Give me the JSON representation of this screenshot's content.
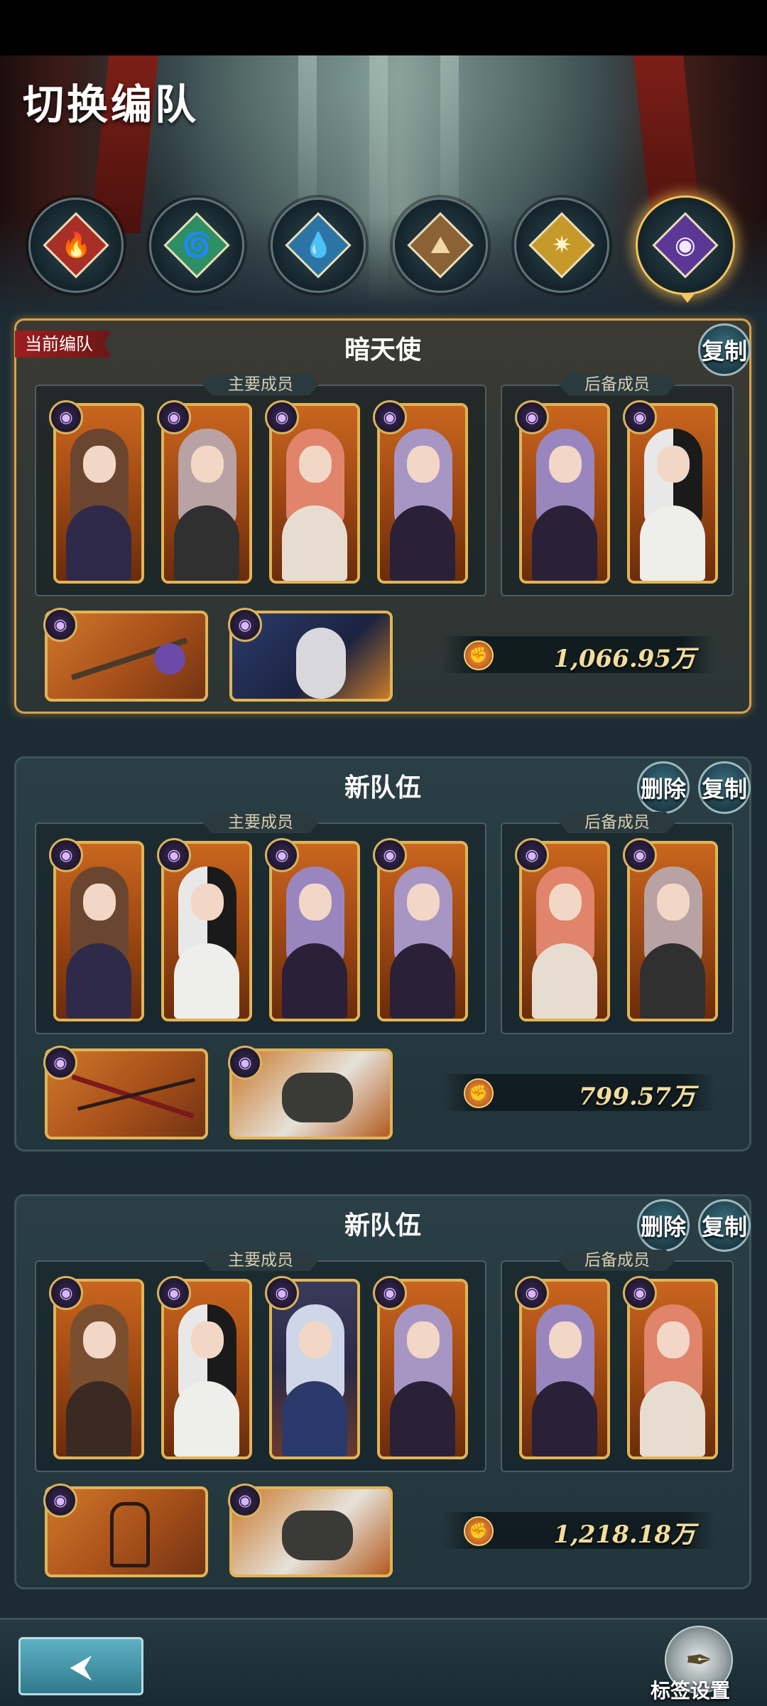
{
  "page": {
    "title": "切换编队"
  },
  "element_tabs": [
    {
      "icon": "fire-element-icon",
      "glyph": "🔥",
      "color": "#c8382f",
      "active": false
    },
    {
      "icon": "wind-element-icon",
      "glyph": "🌀",
      "color": "#3fae7c",
      "active": false
    },
    {
      "icon": "water-element-icon",
      "glyph": "💧",
      "color": "#3f8fc8",
      "active": false
    },
    {
      "icon": "earth-element-icon",
      "glyph": "⛰",
      "color": "#a67c4a",
      "active": false
    },
    {
      "icon": "light-element-icon",
      "glyph": "✷",
      "color": "#e2b83d",
      "active": false
    },
    {
      "icon": "dark-element-icon",
      "glyph": "◉",
      "color": "#7a4bc3",
      "active": true
    }
  ],
  "labels": {
    "main_members": "主要成员",
    "reserve_members": "后备成员",
    "current_team_tag": "当前编队",
    "copy": "复制",
    "delete": "删除"
  },
  "teams": [
    {
      "name": "暗天使",
      "current": true,
      "power": "1,066.95万"
    },
    {
      "name": "新队伍",
      "current": false,
      "power": "799.57万"
    },
    {
      "name": "新队伍",
      "current": false,
      "power": "1,218.18万"
    }
  ],
  "bottom": {
    "back_icon": "back-arrow-icon",
    "tag_settings_label": "标签设置"
  }
}
